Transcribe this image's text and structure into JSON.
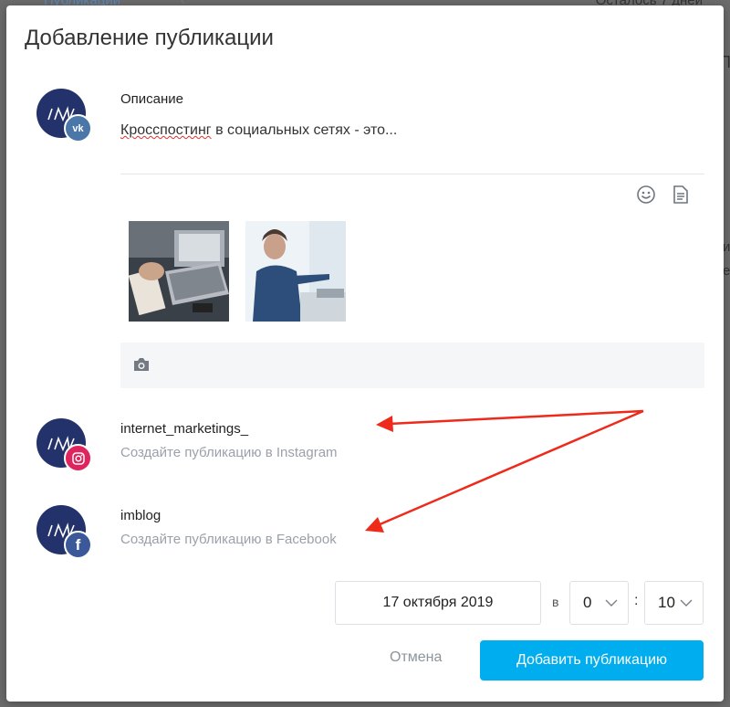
{
  "background": {
    "tab_label": "Публикации",
    "tab_count": "‹",
    "top_right_text": "Осталось 7 дней",
    "right_fragment_1": "П",
    "right_fragment_2": "и е"
  },
  "modal": {
    "title": "Добавление публикации",
    "description": {
      "label": "Описание",
      "text_underlined": "Кросспостинг",
      "text_rest": " в социальных сетях - это..."
    },
    "toolbar": {
      "emoji_icon": "smile-icon",
      "template_icon": "document-icon"
    },
    "photos": [
      {
        "alt": "Фото: работа с ноутбуком"
      },
      {
        "alt": "Фото: презентация у монитора"
      }
    ],
    "photo_bar_icon": "camera-icon",
    "accounts": [
      {
        "name": "internet_marketings_",
        "hint": "Создайте публикацию в Instagram",
        "network": "instagram"
      },
      {
        "name": "imblog",
        "hint": "Создайте публикацию в Facebook",
        "network": "facebook"
      }
    ],
    "schedule": {
      "date": "17 октября 2019",
      "at_label": "в",
      "hour": "0",
      "separator": ":",
      "minute": "10"
    },
    "buttons": {
      "cancel": "Отмена",
      "add": "Добавить публикацию"
    }
  },
  "colors": {
    "accent": "#00adef",
    "avatar": "#24326b",
    "vk": "#4a76a8",
    "instagram": "#e0245e",
    "facebook": "#3b5998",
    "annotation_arrow": "#ee2a1a"
  }
}
